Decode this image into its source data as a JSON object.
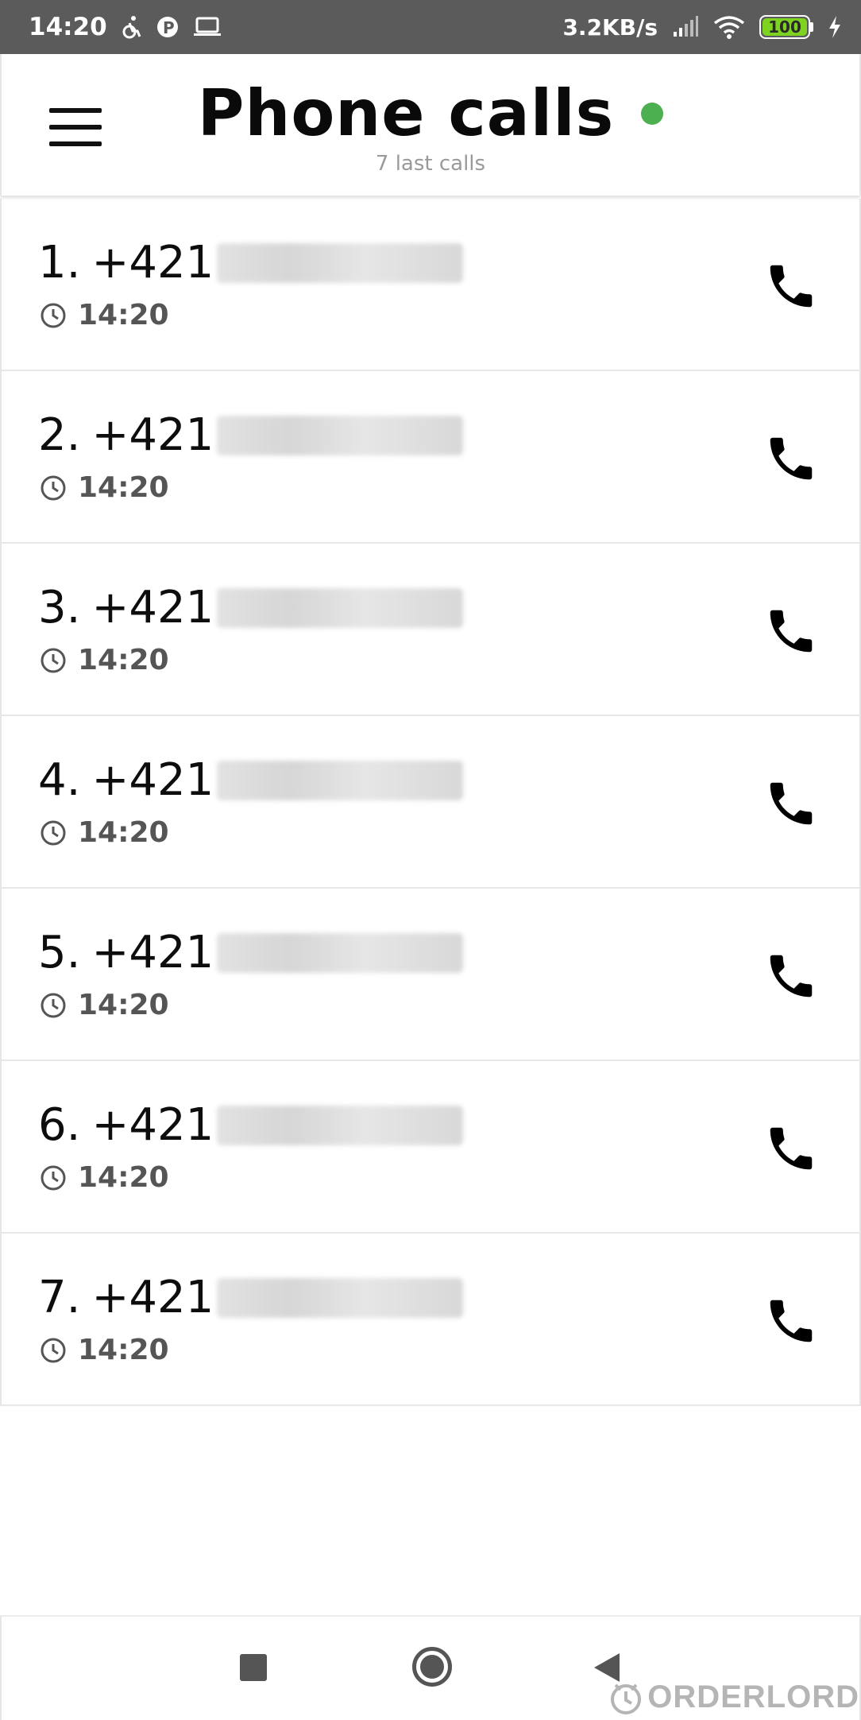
{
  "status_bar": {
    "time": "14:20",
    "net_speed": "3.2KB/s",
    "battery": "100"
  },
  "header": {
    "title": "Phone calls",
    "subtitle": "7 last calls",
    "status_color": "#4caf50"
  },
  "calls": [
    {
      "index": "1.",
      "number": "+421",
      "time": "14:20"
    },
    {
      "index": "2.",
      "number": "+421",
      "time": "14:20"
    },
    {
      "index": "3.",
      "number": "+421",
      "time": "14:20"
    },
    {
      "index": "4.",
      "number": "+421",
      "time": "14:20"
    },
    {
      "index": "5.",
      "number": "+421",
      "time": "14:20"
    },
    {
      "index": "6.",
      "number": "+421",
      "time": "14:20"
    },
    {
      "index": "7.",
      "number": "+421",
      "time": "14:20"
    }
  ],
  "watermark": "ORDERLORD"
}
